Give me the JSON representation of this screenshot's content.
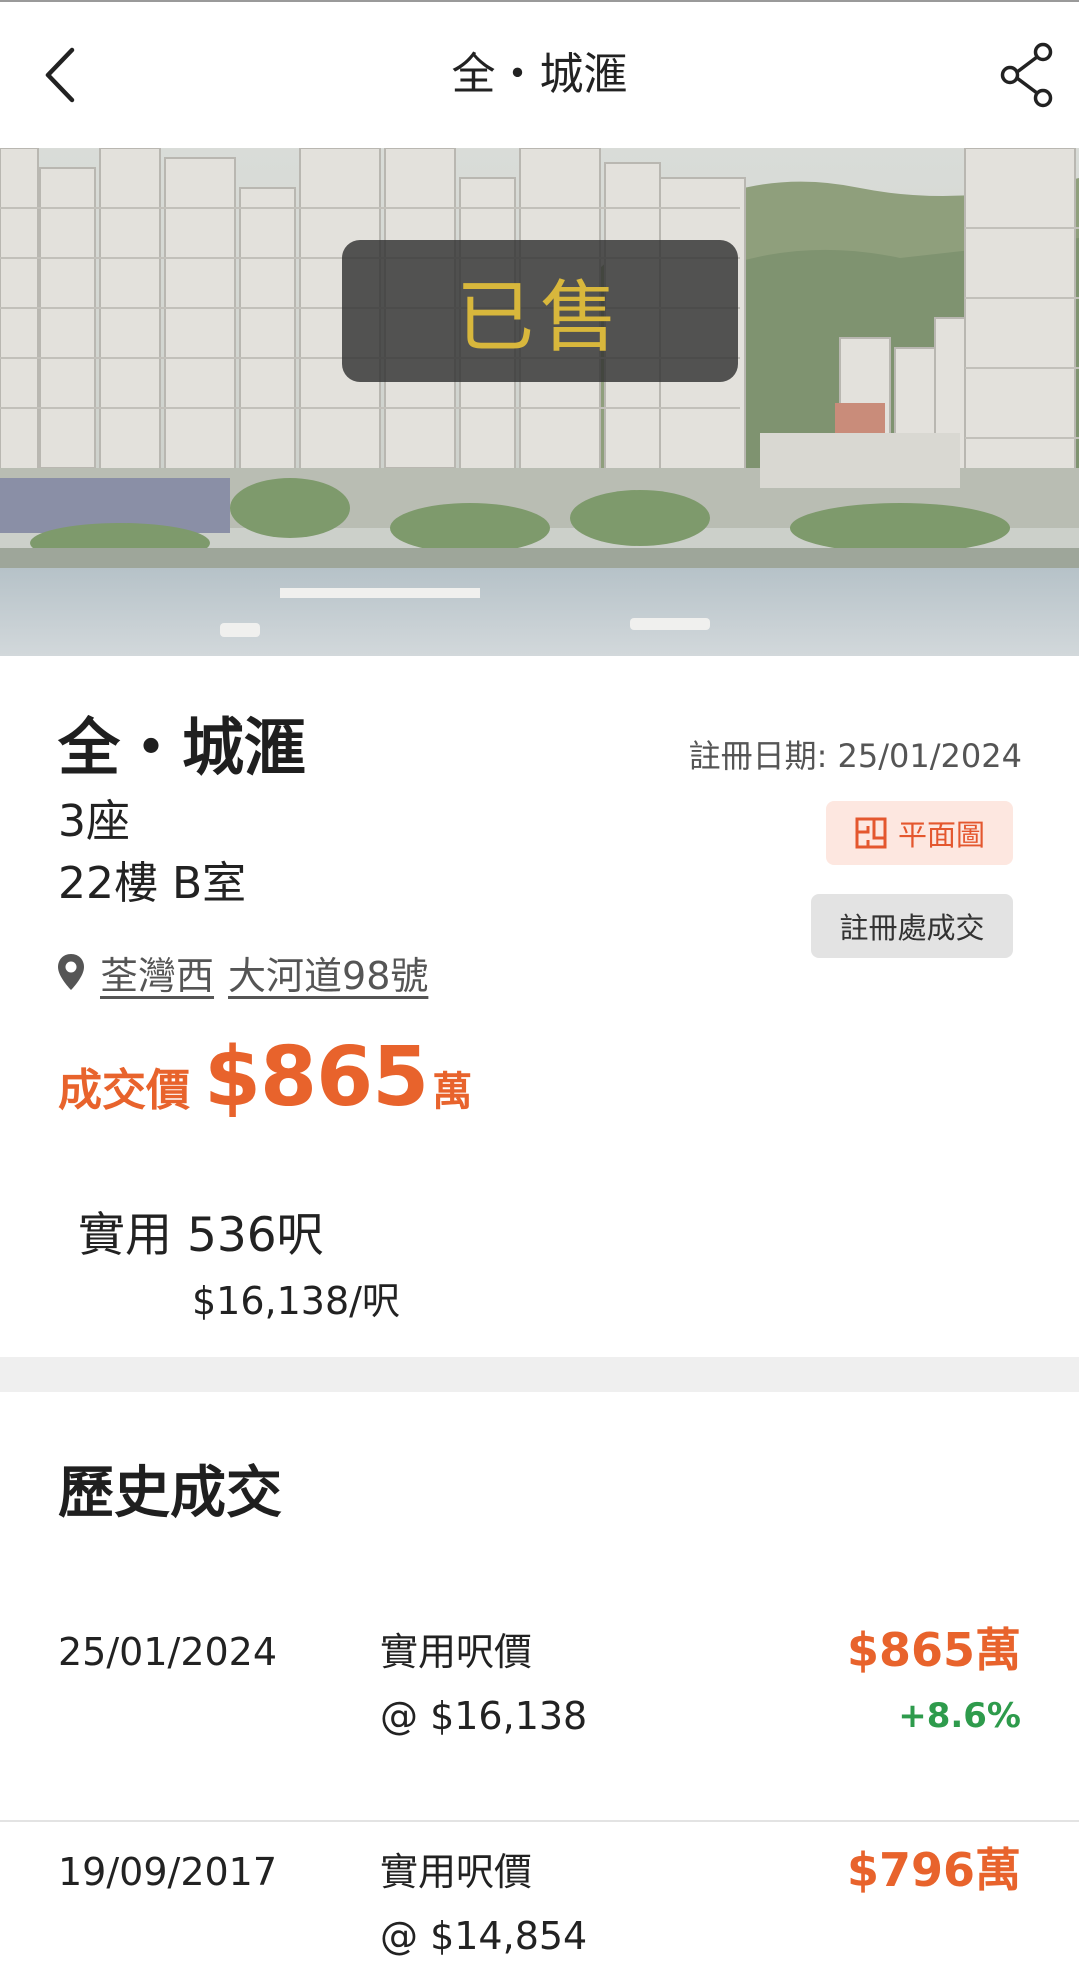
{
  "header": {
    "title": "全・城滙",
    "back_icon": "chevron-left-icon",
    "share_icon": "share-icon"
  },
  "hero": {
    "status_badge": "已售",
    "badge_color": "#d8b73c"
  },
  "property": {
    "name": "全・城滙",
    "block": "3座",
    "unit": "22樓 B室",
    "registration_date": "註冊日期: 25/01/2024",
    "floorplan_label": "平面圖",
    "registry_label": "註冊處成交",
    "district": "荃灣西",
    "address": "大河道98號",
    "price_label": "成交價",
    "price_value": "$865",
    "price_unit": "萬",
    "saleable_area": "實用 536呎",
    "price_per_ft": "$16,138/呎"
  },
  "history": {
    "title": "歷史成交",
    "rows": [
      {
        "date": "25/01/2024",
        "label": "實用呎價",
        "psf": "@ $16,138",
        "price": "$865萬",
        "change": "+8.6%"
      },
      {
        "date": "19/09/2017",
        "label": "實用呎價",
        "psf": "@ $14,854",
        "price": "$796萬",
        "change": ""
      }
    ]
  },
  "colors": {
    "accent": "#e8632c",
    "positive": "#2e9b4c",
    "floorplan_bg": "#fde7e0"
  }
}
